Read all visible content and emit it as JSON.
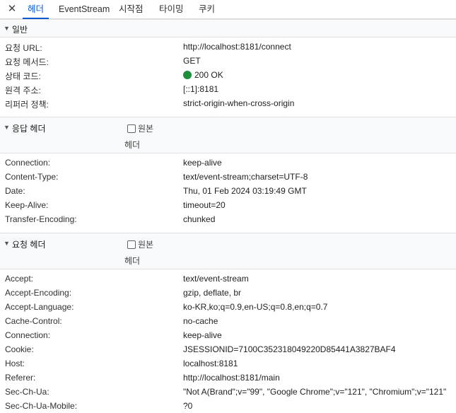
{
  "tabbar": {
    "close_glyph": "✕",
    "tabs": [
      {
        "label": "헤더",
        "active": true
      },
      {
        "label": "EventStream",
        "active": false
      },
      {
        "label": "시작점",
        "active": false
      },
      {
        "label": "타이밍",
        "active": false
      },
      {
        "label": "쿠키",
        "active": false
      }
    ]
  },
  "general": {
    "title": "일반",
    "rows": [
      {
        "key": "요청 URL:",
        "value": "http://localhost:8181/connect"
      },
      {
        "key": "요청 메서드:",
        "value": "GET"
      },
      {
        "key": "상태 코드:",
        "value": "200 OK",
        "status_color": "#1e8e3e"
      },
      {
        "key": "원격 주소:",
        "value": "[::1]:8181"
      },
      {
        "key": "리퍼러 정책:",
        "value": "strict-origin-when-cross-origin"
      }
    ]
  },
  "response_headers": {
    "title": "응답 헤더",
    "raw_label": "원본",
    "raw_sub": "헤더",
    "raw_checked": false,
    "rows": [
      {
        "key": "Connection:",
        "value": "keep-alive"
      },
      {
        "key": "Content-Type:",
        "value": "text/event-stream;charset=UTF-8"
      },
      {
        "key": "Date:",
        "value": "Thu, 01 Feb 2024 03:19:49 GMT"
      },
      {
        "key": "Keep-Alive:",
        "value": "timeout=20"
      },
      {
        "key": "Transfer-Encoding:",
        "value": "chunked"
      }
    ]
  },
  "request_headers": {
    "title": "요청 헤더",
    "raw_label": "원본",
    "raw_sub": "헤더",
    "raw_checked": false,
    "rows": [
      {
        "key": "Accept:",
        "value": "text/event-stream"
      },
      {
        "key": "Accept-Encoding:",
        "value": "gzip, deflate, br"
      },
      {
        "key": "Accept-Language:",
        "value": "ko-KR,ko;q=0.9,en-US;q=0.8,en;q=0.7"
      },
      {
        "key": "Cache-Control:",
        "value": "no-cache"
      },
      {
        "key": "Connection:",
        "value": "keep-alive"
      },
      {
        "key": "Cookie:",
        "value": "JSESSIONID=7100C352318049220D85441A3827BAF4"
      },
      {
        "key": "Host:",
        "value": "localhost:8181"
      },
      {
        "key": "Referer:",
        "value": "http://localhost:8181/main"
      },
      {
        "key": "Sec-Ch-Ua:",
        "value": "\"Not A(Brand\";v=\"99\", \"Google Chrome\";v=\"121\", \"Chromium\";v=\"121\""
      },
      {
        "key": "Sec-Ch-Ua-Mobile:",
        "value": "?0"
      }
    ]
  }
}
